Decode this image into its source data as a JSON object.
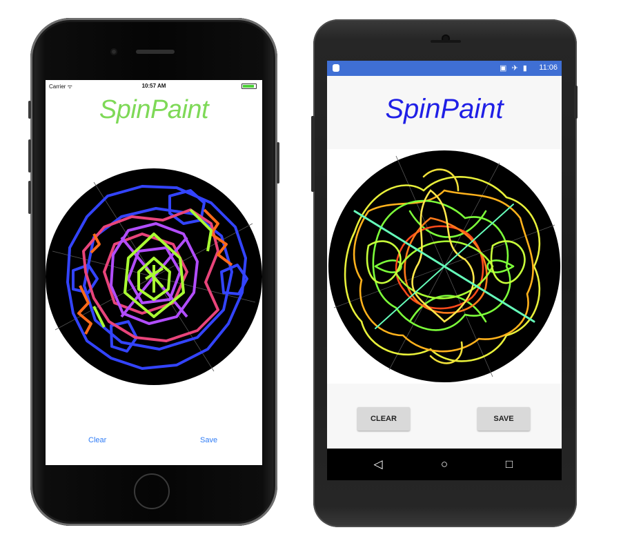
{
  "ios": {
    "status": {
      "carrier": "Carrier ᯤ",
      "time": "10:57 AM"
    },
    "title": "SpinPaint",
    "title_color": "#7ed957",
    "buttons": {
      "clear": "Clear",
      "save": "Save"
    },
    "button_color": "#2f7cf6"
  },
  "android": {
    "status": {
      "time": "11:06",
      "icons": "▣ ✈ ▮"
    },
    "title": "SpinPaint",
    "title_color": "#1f1fe6",
    "buttons": {
      "clear": "CLEAR",
      "save": "SAVE"
    },
    "nav": {
      "back": "◁",
      "home": "○",
      "recents": "□"
    },
    "status_bar_color": "#3f6fd4"
  }
}
